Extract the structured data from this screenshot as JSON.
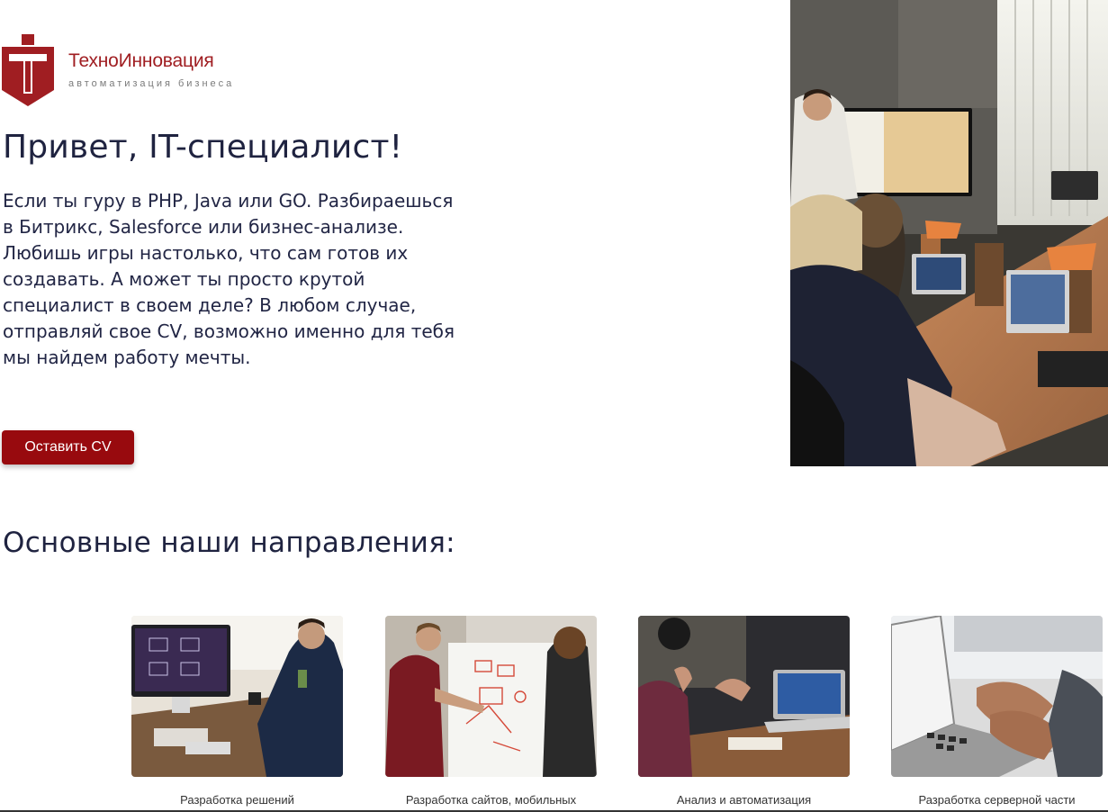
{
  "brand": {
    "name": "ТехноИнновация",
    "tagline": "автоматизация бизнеса",
    "color": "#a01e22"
  },
  "hero": {
    "title": "Привет, IT-специалист!",
    "text": "Если ты гуру в PHP, Java или GO. Разбираешься в Битрикс, Salesforce или бизнес-анализе. Любишь игры настолько, что сам готов их создавать. А может ты просто крутой специалист в своем деле? В любом случае, отправляй свое CV, возможно именно для тебя мы найдем работу мечты.",
    "button_label": "Оставить CV",
    "button_color": "#980a0e"
  },
  "directions": {
    "title": "Основные наши направления:",
    "cards": [
      {
        "caption": "Разработка решений"
      },
      {
        "caption": "Разработка сайтов, мобильных"
      },
      {
        "caption": "Анализ и автоматизация"
      },
      {
        "caption": "Разработка серверной части"
      }
    ]
  }
}
